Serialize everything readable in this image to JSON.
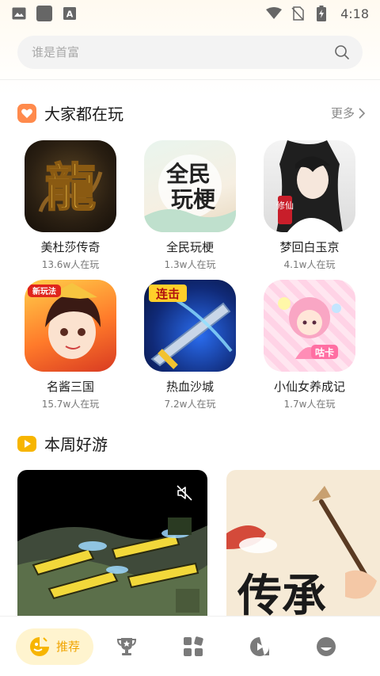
{
  "status_bar": {
    "time": "4:18"
  },
  "search": {
    "placeholder": "谁是首富"
  },
  "section_popular": {
    "title": "大家都在玩",
    "more_label": "更多",
    "games": [
      {
        "name": "美杜莎传奇",
        "players": "13.6w人在玩",
        "icon_text": "龍"
      },
      {
        "name": "全民玩梗",
        "players": "1.3w人在玩",
        "icon_text_1": "全民",
        "icon_text_2": "玩梗"
      },
      {
        "name": "梦回白玉京",
        "players": "4.1w人在玩",
        "icon_text": "修仙"
      },
      {
        "name": "名酱三国",
        "players": "15.7w人在玩",
        "icon_text": "新玩法"
      },
      {
        "name": "热血沙城",
        "players": "7.2w人在玩",
        "icon_text": "连击"
      },
      {
        "name": "小仙女养成记",
        "players": "1.7w人在玩",
        "icon_text": "咕卡"
      }
    ]
  },
  "section_weekly": {
    "title": "本周好游",
    "card2_text": "传承"
  },
  "bottom_nav": {
    "active_label": "推荐",
    "items": [
      "recommend",
      "trophy",
      "categories",
      "video",
      "profile"
    ]
  },
  "colors": {
    "accent": "#f7b500",
    "section_icon_orange": "#ff8a4c",
    "active_nav_bg": "#fff4cf"
  }
}
